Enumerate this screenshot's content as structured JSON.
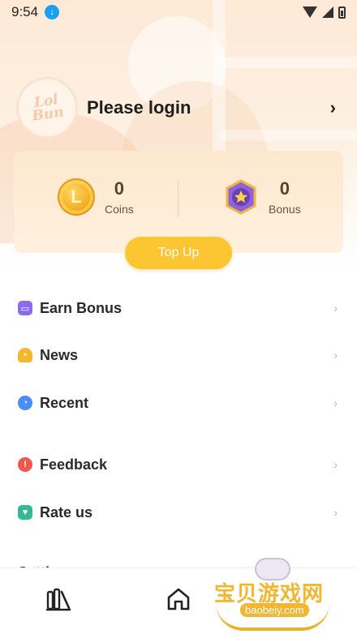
{
  "status_bar": {
    "time": "9:54",
    "download_icon": "download-icon",
    "wifi_icon": "wifi-icon",
    "signal_icon": "signal-icon",
    "battery_icon": "battery-icon"
  },
  "profile": {
    "avatar_text": "Lol\nBun",
    "login_text": "Please login",
    "chevron_icon": "chevron-right-icon"
  },
  "wallet": {
    "coins": {
      "value": "0",
      "label": "Coins",
      "icon": "coin-icon"
    },
    "bonus": {
      "value": "0",
      "label": "Bonus",
      "icon": "star-badge-icon"
    },
    "topup_label": "Top Up"
  },
  "menu": {
    "items": [
      {
        "label": "Earn Bonus",
        "icon": "treasure-chest-icon",
        "color": "#8b6cf0"
      },
      {
        "label": "News",
        "icon": "bell-icon",
        "color": "#f7b72a"
      },
      {
        "label": "Recent",
        "icon": "clock-icon",
        "color": "#4a8ef5"
      },
      {
        "label": "Feedback",
        "icon": "alert-icon",
        "color": "#f0584d"
      },
      {
        "label": "Rate us",
        "icon": "heart-icon",
        "color": "#35b896"
      }
    ],
    "settings_peek": "Setti"
  },
  "bottom_nav": {
    "items": [
      {
        "icon": "library-icon"
      },
      {
        "icon": "home-icon"
      }
    ]
  },
  "watermark": {
    "title": "宝贝游戏网",
    "url": "baobeiy.com"
  },
  "colors": {
    "accent": "#fcc632",
    "wallet_text": "#5a4330",
    "card_bg": "#fde8cf"
  }
}
